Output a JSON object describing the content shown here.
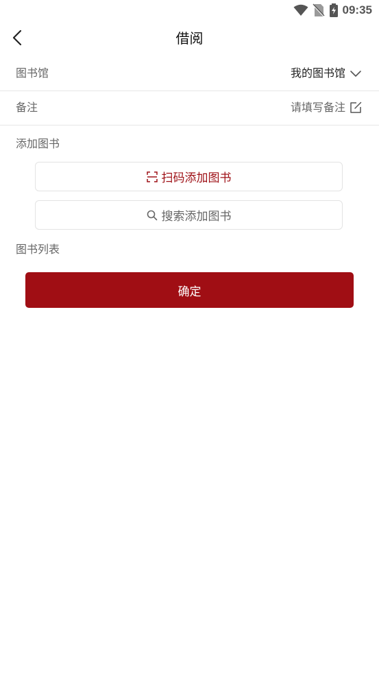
{
  "status_bar": {
    "time": "09:35",
    "icons": [
      "wifi-icon",
      "no-sim-icon",
      "battery-charging-icon"
    ]
  },
  "header": {
    "title": "借阅",
    "back_icon": "chevron-left-icon"
  },
  "form": {
    "library": {
      "label": "图书馆",
      "value": "我的图书馆",
      "icon": "chevron-down-icon"
    },
    "remark": {
      "label": "备注",
      "placeholder": "请填写备注",
      "icon": "edit-icon"
    }
  },
  "add_books": {
    "label": "添加图书",
    "scan_label": "扫码添加图书",
    "search_label": "搜索添加图书"
  },
  "book_list": {
    "label": "图书列表"
  },
  "confirm_label": "确定",
  "colors": {
    "accent": "#a00e14",
    "scan_text": "#9e1016",
    "label_text": "#666666",
    "divider": "#e6e6e6"
  }
}
